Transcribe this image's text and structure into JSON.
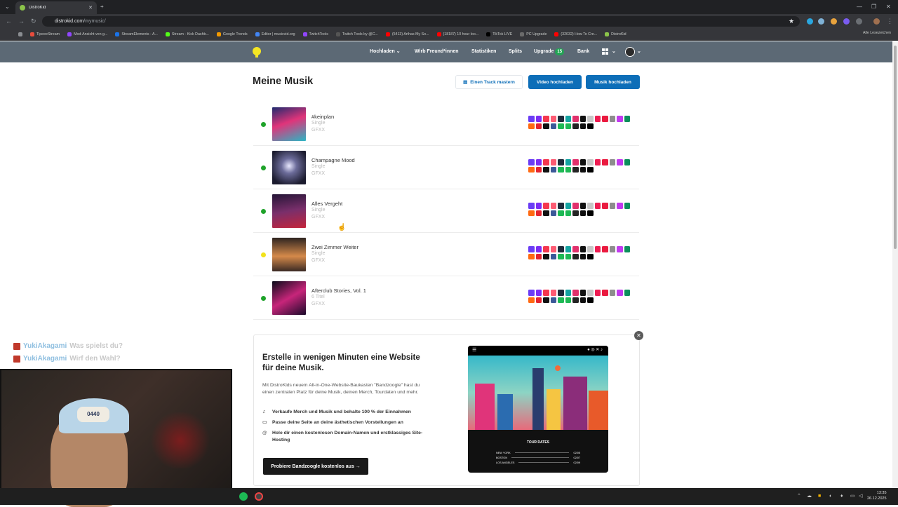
{
  "browser": {
    "tab_title": "DistroKid",
    "url_host": "distrokid.com",
    "url_path": "/mymusic/",
    "bookmarks": [
      {
        "label": "TipeeeStream",
        "color": "#e74c3c"
      },
      {
        "label": "Mod-Ansicht von g...",
        "color": "#9146ff"
      },
      {
        "label": "StreamElements - A...",
        "color": "#1a73e8"
      },
      {
        "label": "Stream - Kick Dashb...",
        "color": "#53fc18"
      },
      {
        "label": "Google Trends",
        "color": "#f29900"
      },
      {
        "label": "Editor | musicvid.org",
        "color": "#4285f4"
      },
      {
        "label": "TwitchTools",
        "color": "#9146ff"
      },
      {
        "label": "Twitch Tools by @C...",
        "color": "#555555"
      },
      {
        "label": "(5413) Arthas My So...",
        "color": "#ff0000"
      },
      {
        "label": "(18187) 10 hour loo...",
        "color": "#ff0000"
      },
      {
        "label": "TikTok LIVE",
        "color": "#000000"
      },
      {
        "label": "PC Upgrade",
        "color": "#6b6b6b"
      },
      {
        "label": "(32032) How To Cre...",
        "color": "#ff0000"
      },
      {
        "label": "DistroKid",
        "color": "#8bc34a"
      }
    ],
    "bookmarks_right": "Alle Lesezeichen"
  },
  "site_nav": {
    "upload": "Hochladen",
    "refer": "Wirb Freund*innen",
    "stats": "Statistiken",
    "splits": "Splits",
    "upgrade": "Upgrade",
    "upgrade_badge": "15",
    "bank": "Bank"
  },
  "main": {
    "title": "Meine Musik",
    "btn_master": "Einen Track mastern",
    "btn_video": "Video hochladen",
    "btn_music": "Musik hochladen"
  },
  "tracks": [
    {
      "title": "#keinplan",
      "type": "Single",
      "artist": "GFXX",
      "status": "#1fa32a",
      "cover": "linear-gradient(160deg,#1e2a6e 0%,#e0347a 45%,#2ab6c4 100%)"
    },
    {
      "title": "Champagne Mood",
      "type": "Single",
      "artist": "GFXX",
      "status": "#1fa32a",
      "cover": "radial-gradient(circle at 50% 45%,#e8e8ff 0%,#6c6c9a 30%,#1b1b2e 80%)"
    },
    {
      "title": "Alles Vergeht",
      "type": "Single",
      "artist": "GFXX",
      "status": "#1fa32a",
      "cover": "linear-gradient(170deg,#241536 0%,#7a2f6b 50%,#c4243a 100%)"
    },
    {
      "title": "Zwei Zimmer Weiter",
      "type": "Single",
      "artist": "GFXX",
      "status": "#f2e21a",
      "cover": "linear-gradient(180deg,#2e2420 0%,#d58a4a 55%,#3a2a24 100%)"
    },
    {
      "title": "Afterclub Stories, Vol. 1",
      "type": "6 Titel",
      "artist": "GFXX",
      "status": "#1fa32a",
      "cover": "linear-gradient(150deg,#0b0b1a 0%,#c7257a 50%,#1a0a2a 100%)"
    }
  ],
  "store_colors": [
    "#6a3df5",
    "#7b2cf5",
    "#f5374e",
    "#fd5b73",
    "#1e2a3a",
    "#13a4a2",
    "#e1306c",
    "#111111",
    "#c7c7c7",
    "#ee1d52",
    "#ea1a3f",
    "#8d8d8d",
    "#c23aef",
    "#0b8f5c",
    "#ff6a13",
    "#e52430",
    "#111111",
    "#3b5998",
    "#1db954",
    "#1db954",
    "#232323",
    "#0f0f0f",
    "#000000"
  ],
  "promo": {
    "title": "Erstelle in wenigen Minuten eine Website für deine Musik.",
    "text": "Mit DistroKids neuem All-in-One-Website-Baukasten \"Bandzoogle\" hast du einen zentralen Platz für deine Musik, deinen Merch, Tourdaten und mehr.",
    "features": [
      {
        "icon": "♫",
        "text": "Verkaufe Merch und Musik und behalte 100 % der Einnahmen"
      },
      {
        "icon": "▭",
        "text": "Passe deine Seite an deine ästhetischen Vorstellungen an"
      },
      {
        "icon": "@",
        "text": "Hole dir einen kostenlosen Domain-Namen und erstklassiges Site-Hosting"
      }
    ],
    "cta": "Probiere Bandzoogle kostenlos aus →",
    "tour_title": "TOUR DATES",
    "tour_rows": [
      {
        "city": "NEW YORK",
        "date": "02/05"
      },
      {
        "city": "BOSTON",
        "date": "02/07"
      },
      {
        "city": "LOS ANGELES",
        "date": "02/09"
      }
    ]
  },
  "chat": [
    {
      "user": "YukiAkagami",
      "msg": "Was spielst du?"
    },
    {
      "user": "YukiAkagami",
      "msg": "Wirf den Wahl?"
    }
  ],
  "webcam": {
    "cap_text": "0440"
  },
  "taskbar": {
    "time": "13:35",
    "date": "26.12.2025"
  }
}
